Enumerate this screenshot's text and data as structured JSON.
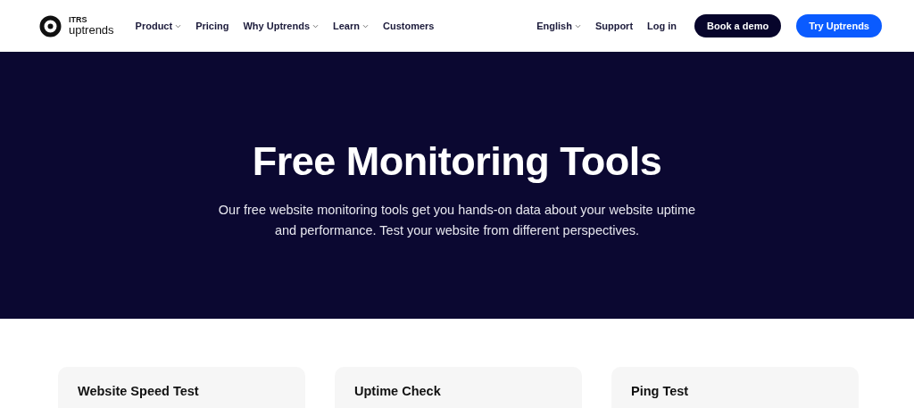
{
  "logo": {
    "line_1": "ITRS",
    "line_2": "uptrends"
  },
  "nav": [
    {
      "label": "Product",
      "has_menu": true
    },
    {
      "label": "Pricing",
      "has_menu": false
    },
    {
      "label": "Why Uptrends",
      "has_menu": true
    },
    {
      "label": "Learn",
      "has_menu": true
    },
    {
      "label": "Customers",
      "has_menu": false
    }
  ],
  "nav_right": [
    {
      "label": "English",
      "has_menu": true
    },
    {
      "label": "Support",
      "has_menu": false
    },
    {
      "label": "Log in",
      "has_menu": false
    }
  ],
  "buttons": [
    {
      "label": "Book a demo",
      "kind": "dark"
    },
    {
      "label": "Try Uptrends",
      "kind": "primary"
    }
  ],
  "hero": {
    "title": "Free Monitoring Tools",
    "text": "Our free website monitoring tools get you hands-on data about your website uptime and performance. Test your website from different perspectives."
  },
  "tools": [
    {
      "title": "Website Speed Test"
    },
    {
      "title": "Uptime Check"
    },
    {
      "title": "Ping Test"
    }
  ]
}
